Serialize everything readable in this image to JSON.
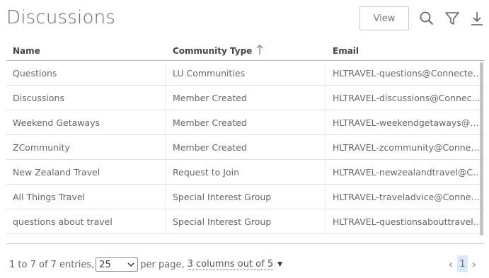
{
  "page": {
    "title": "Discussions"
  },
  "toolbar": {
    "view_label": "View",
    "icons": [
      "search-icon",
      "filter-icon",
      "download-icon"
    ]
  },
  "table": {
    "columns": [
      "Name",
      "Community Type",
      "Email"
    ],
    "sort": {
      "column": "Community Type",
      "direction": "ascending"
    },
    "rows": [
      {
        "name": "Questions",
        "type": "LU Communities",
        "email": "HLTRAVEL-questions@ConnectedCommunity.org"
      },
      {
        "name": "Discussions",
        "type": "Member Created",
        "email": "HLTRAVEL-discussions@ConnectedCommunity.org"
      },
      {
        "name": "Weekend Getaways",
        "type": "Member Created",
        "email": "HLTRAVEL-weekendgetaways@ConnectedCommunity.org"
      },
      {
        "name": "ZCommunity",
        "type": "Member Created",
        "email": "HLTRAVEL-zcommunity@ConnectedCommunity.org"
      },
      {
        "name": "New Zealand Travel",
        "type": "Request to Join",
        "email": "HLTRAVEL-newzealandtravel@ConnectedCommunity.org"
      },
      {
        "name": "All Things Travel",
        "type": "Special Interest Group",
        "email": "HLTRAVEL-traveladvice@ConnectedCommunity.org"
      },
      {
        "name": "questions about travel",
        "type": "Special Interest Group",
        "email": "HLTRAVEL-questionsabouttravel@ConnectedCommunity.org"
      }
    ]
  },
  "footer": {
    "entries_text": "1 to 7 of 7 entries,",
    "per_page_value": "25",
    "per_page_label": "per page,",
    "columns_text": "3 columns out of 5"
  },
  "pagination": {
    "current_page": "1"
  },
  "colors": {
    "accent": "#4a6e96",
    "page_highlight": "#dde9f5"
  }
}
